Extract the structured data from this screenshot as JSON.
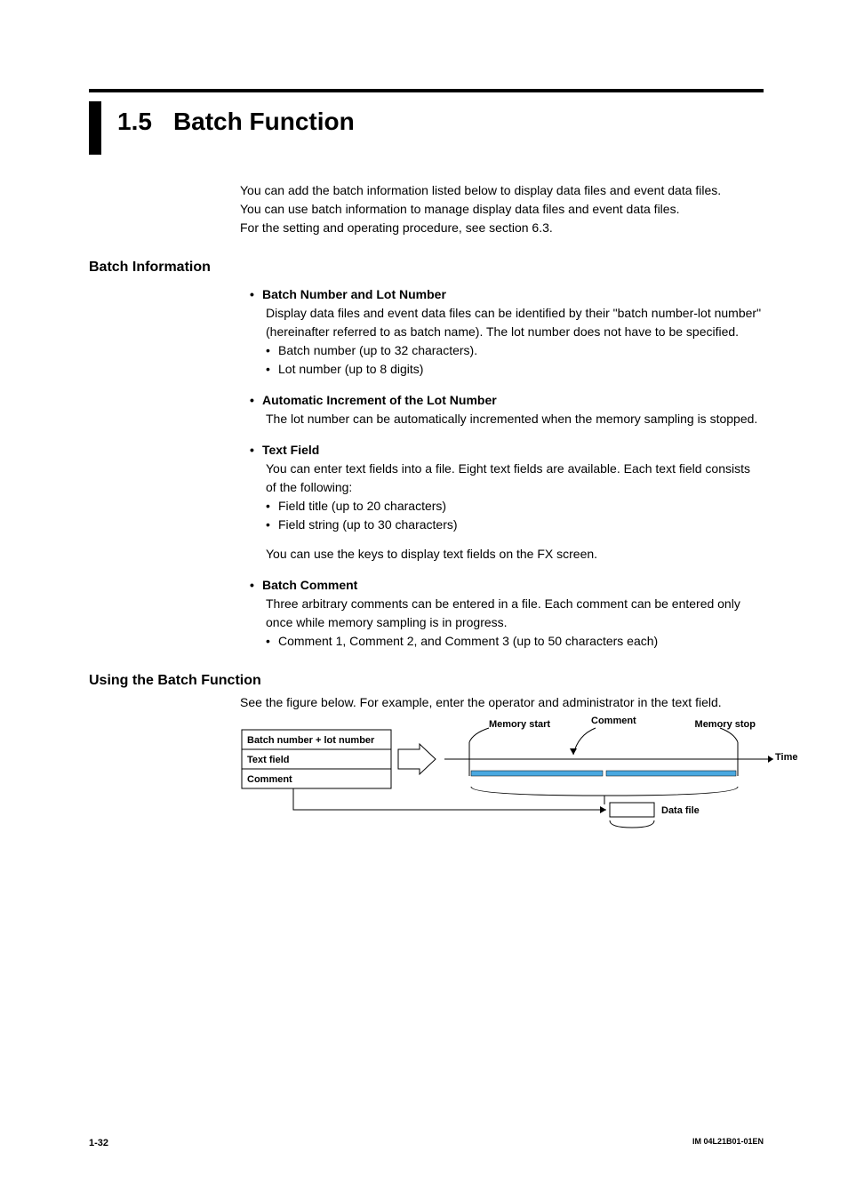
{
  "title": {
    "number": "1.5",
    "text": "Batch Function"
  },
  "intro": [
    "You can add the batch information listed below to display data files and event data files.",
    "You can use batch information to manage display data files and event data files.",
    "For the setting and operating procedure, see section 6.3."
  ],
  "section1": {
    "heading": "Batch Information",
    "items": [
      {
        "title": "Batch Number and Lot Number",
        "body": "Display data files and event data files can be identified by their \"batch number-lot number\" (hereinafter referred to as batch name). The lot number does not have to be specified.",
        "subs": [
          "Batch number (up to 32 characters).",
          "Lot number (up to 8 digits)"
        ]
      },
      {
        "title": "Automatic Increment of the Lot Number",
        "body": "The lot number can be automatically incremented when the memory sampling is stopped."
      },
      {
        "title": "Text Field",
        "body": "You can enter text fields into a file. Eight text fields are available. Each text field consists of the following:",
        "subs": [
          "Field title (up to 20 characters)",
          "Field string (up to 30 characters)"
        ],
        "after": "You can use the keys to display text fields on the FX screen."
      },
      {
        "title": "Batch Comment",
        "body": "Three arbitrary comments can be entered in a file. Each comment can be entered only once while memory sampling is in progress.",
        "subs": [
          "Comment 1, Comment 2, and Comment 3 (up to 50 characters each)"
        ]
      }
    ]
  },
  "section2": {
    "heading": "Using the Batch Function",
    "body": "See the figure below. For example, enter the operator and administrator in the text field."
  },
  "figure": {
    "box_rows": [
      "Batch number + lot number",
      "Text field",
      "Comment"
    ],
    "labels": {
      "memory_start": "Memory start",
      "comment": "Comment",
      "memory_stop": "Memory stop",
      "time": "Time",
      "data_file": "Data file"
    }
  },
  "footer": {
    "page": "1-32",
    "doc_id": "IM 04L21B01-01EN"
  }
}
